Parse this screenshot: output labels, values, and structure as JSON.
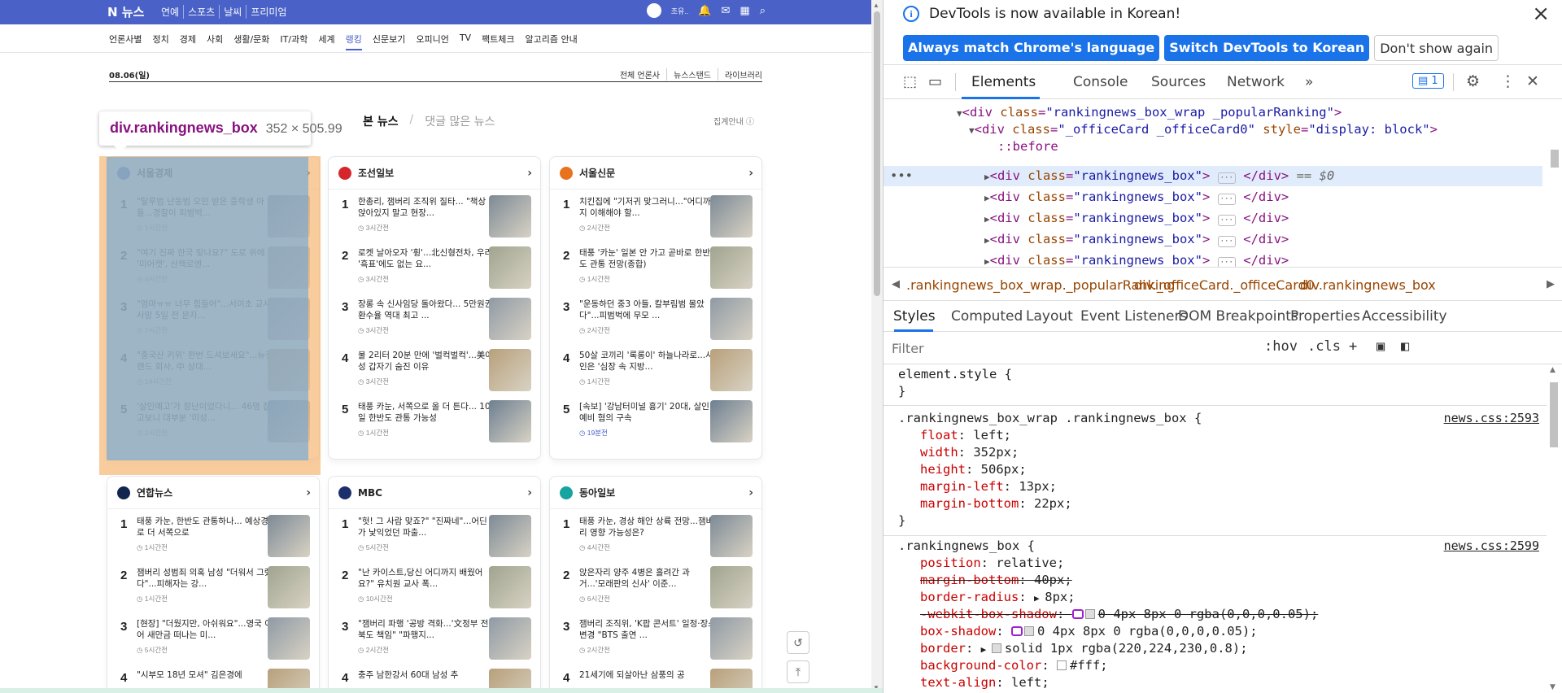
{
  "page": {
    "topbar": {
      "logo": "N 뉴스",
      "sections": [
        "연예",
        "스포츠",
        "날씨",
        "프리미엄"
      ],
      "user_name": "조유..",
      "icons": [
        "avatar-icon",
        "bell-icon",
        "mail-icon",
        "grid-icon",
        "search-icon"
      ]
    },
    "categories": [
      "언론사별",
      "정치",
      "경제",
      "사회",
      "생활/문화",
      "IT/과학",
      "세계",
      "랭킹",
      "신문보기",
      "오피니언",
      "TV",
      "팩트체크",
      "알고리즘 안내"
    ],
    "active_category": "랭킹",
    "date": "08.06(일)",
    "date_links": [
      "전체 언론사",
      "뉴스스탠드",
      "라이브러리"
    ],
    "rank_tabs": {
      "active": "본 뉴스",
      "inactive": "댓글 많은 뉴스"
    },
    "rank_help": "집계안내 ⓘ",
    "inspector_tooltip": {
      "tag": "div.rankingnews_box",
      "dims": "352 × 505.99"
    },
    "boxes": [
      {
        "press": "서울경제",
        "logo_color": "#3b6bb8",
        "items": [
          {
            "n": "1",
            "title": "\"탈루범 난동범 오인 받은 중학생 아들...경찰이 피범벅...",
            "time": "1시간전"
          },
          {
            "n": "2",
            "title": "\"여기 진짜 한국 맞나요?\" 도로 위에 '미어캣', 산책로엔...",
            "time": "4시간전"
          },
          {
            "n": "3",
            "title": "\"엄마ㅠㅠ 너무 힘들어\"...서이초 교사 사망 5일 전 문자...",
            "time": "7시간전"
          },
          {
            "n": "4",
            "title": "\"중국산 키위' 한번 드셔보세요\"...뉴질랜드 회사, 中 상대...",
            "time": "14시간전"
          },
          {
            "n": "5",
            "title": "'살인예고'가 장난이었다니... 46명 잡고보니 대부분 '미성...",
            "time": "2시간전"
          }
        ]
      },
      {
        "press": "조선일보",
        "logo_color": "#d7262b",
        "items": [
          {
            "n": "1",
            "title": "한총리, 잼버리 조직위 질타... \"책상 앉아있지 말고 현장...",
            "time": "3시간전"
          },
          {
            "n": "2",
            "title": "로켓 날아오자 '휭'...北신형전차, 우리 '흑표'에도 없는 요...",
            "time": "3시간전"
          },
          {
            "n": "3",
            "title": "장롱 속 신사임당 돌아왔다... 5만원권 환수율 역대 최고 ...",
            "time": "3시간전"
          },
          {
            "n": "4",
            "title": "물 2리터 20분 만에 '벌컥벌컥'...美여성 갑자기 숨진 이유",
            "time": "3시간전"
          },
          {
            "n": "5",
            "title": "태풍 카눈, 서쪽으로 올 더 튼다... 10일 한반도 관통 가능성",
            "time": "1시간전"
          }
        ]
      },
      {
        "press": "서울신문",
        "logo_color": "#e8731e",
        "items": [
          {
            "n": "1",
            "title": "치킨집에 \"기저귀 맞그러니...\"어디까지 이해해야 할...",
            "time": "2시간전"
          },
          {
            "n": "2",
            "title": "태풍 '카눈' 일본 안 가고 곧바로 한반도 관통 전망(종합)",
            "time": "1시간전"
          },
          {
            "n": "3",
            "title": "\"운동하던 중3 아들, 칼부림범 몰았다\"...피범벅에 무모 ...",
            "time": "2시간전"
          },
          {
            "n": "4",
            "title": "50살 코끼리 '록롱이' 하늘나라로...사인은 '심장 속 지방...",
            "time": "1시간전"
          },
          {
            "n": "5",
            "title": "[속보] '강남터미널 흉기' 20대, 살인예비 혐의 구속",
            "time": "19분전",
            "new": true
          }
        ]
      },
      {
        "press": "연합뉴스",
        "logo_color": "#12254e",
        "items": [
          {
            "n": "1",
            "title": "태풍 카눈, 한반도 관통하나... 예상경로 더 서쪽으로",
            "time": "1시간전"
          },
          {
            "n": "2",
            "title": "잼버리 성범죄 의혹 남성 \"더워서 그랬다\"...피해자는 강...",
            "time": "1시간전"
          },
          {
            "n": "3",
            "title": "[현장] \"더웠지만, 아쉬워요\"...영국 이어 새만금 떠나는 미...",
            "time": "5시간전"
          },
          {
            "n": "4",
            "title": "\"시부모 18년 모셔\" 김은경에",
            "time": ""
          }
        ]
      },
      {
        "press": "MBC",
        "logo_color": "#1d2f6b",
        "items": [
          {
            "n": "1",
            "title": "\"헛! 그 사람 맞죠?\" \"진짜네\"...어딘가 낯익었던 파출...",
            "time": "5시간전"
          },
          {
            "n": "2",
            "title": "\"난 카이스트,당신 어디까지 배웠어요?\" 유치원 교사 폭...",
            "time": "10시간전"
          },
          {
            "n": "3",
            "title": "\"잼버리 파행 '공방 격화...'文정부 전북도 책임\" \"파행지...",
            "time": "2시간전"
          },
          {
            "n": "4",
            "title": "충주 남한강서 60대 남성 추",
            "time": ""
          }
        ]
      },
      {
        "press": "동아일보",
        "logo_color": "#17a3a0",
        "items": [
          {
            "n": "1",
            "title": "태풍 카눈, 경상 해안 상륙 전망...잼버리 영향 가능성은?",
            "time": "4시간전"
          },
          {
            "n": "2",
            "title": "앉은자리 양주 4병은 흘려간 과거...'모래판의 신사' 이준...",
            "time": "6시간전"
          },
          {
            "n": "3",
            "title": "잼버리 조직위, 'K팝 콘서트' 일정·장소 변경 \"BTS 출연 ...",
            "time": "2시간전"
          },
          {
            "n": "4",
            "title": "21세기에 되살아난 삼풍의 공",
            "time": ""
          }
        ]
      }
    ]
  },
  "devtools": {
    "infobar": {
      "message": "DevTools is now available in Korean!",
      "btn_match": "Always match Chrome's language",
      "btn_switch": "Switch DevTools to Korean",
      "btn_dismiss": "Don't show again"
    },
    "tabs": [
      "Elements",
      "Console",
      "Sources",
      "Network"
    ],
    "active_tab": "Elements",
    "issues_count": "1",
    "dom": {
      "line0_attr": "class",
      "line0_val": "\"rankingnews_box_wrap _popularRanking\"",
      "line1_attr": "class",
      "line1_val": "\"_officeCard _officeCard0\"",
      "line1_attr2": "style",
      "line1_val2": "\"display: block\"",
      "pseudo": "::before",
      "box_class_val": "\"rankingnews_box\"",
      "selected_marker": "== $0"
    },
    "breadcrumbs": [
      ".rankingnews_box_wrap._popularRanking",
      "div._officeCard._officeCard0",
      "div.rankingnews_box"
    ],
    "subtabs": [
      "Styles",
      "Computed",
      "Layout",
      "Event Listeners",
      "DOM Breakpoints",
      "Properties",
      "Accessibility"
    ],
    "filter_placeholder": "Filter",
    "filter_tools": [
      ":hov",
      ".cls"
    ],
    "styles": {
      "element_style": "element.style {",
      "rule1": {
        "selector": ".rankingnews_box_wrap .rankingnews_box {",
        "source": "news.css:2593",
        "decls": [
          {
            "p": "float",
            "v": "left;"
          },
          {
            "p": "width",
            "v": "352px;"
          },
          {
            "p": "height",
            "v": "506px;"
          },
          {
            "p": "margin-left",
            "v": "13px;"
          },
          {
            "p": "margin-bottom",
            "v": "22px;"
          }
        ]
      },
      "rule2": {
        "selector": ".rankingnews_box {",
        "source": "news.css:2599",
        "decls": [
          {
            "p": "position",
            "v": "relative;"
          },
          {
            "p": "margin-bottom",
            "v": "40px;",
            "struck": true
          },
          {
            "p": "border-radius",
            "v": "8px;"
          },
          {
            "p": "-webkit-box-shadow",
            "v": "0 4px 8px 0 rgba(0,0,0,0.05);",
            "struck": true
          },
          {
            "p": "box-shadow",
            "v": "0 4px 8px 0 rgba(0,0,0,0.05);"
          },
          {
            "p": "border",
            "v": "solid 1px rgba(220,224,230,0.8);"
          },
          {
            "p": "background-color",
            "v": "#fff;"
          },
          {
            "p": "text-align",
            "v": "left;"
          }
        ]
      }
    }
  }
}
